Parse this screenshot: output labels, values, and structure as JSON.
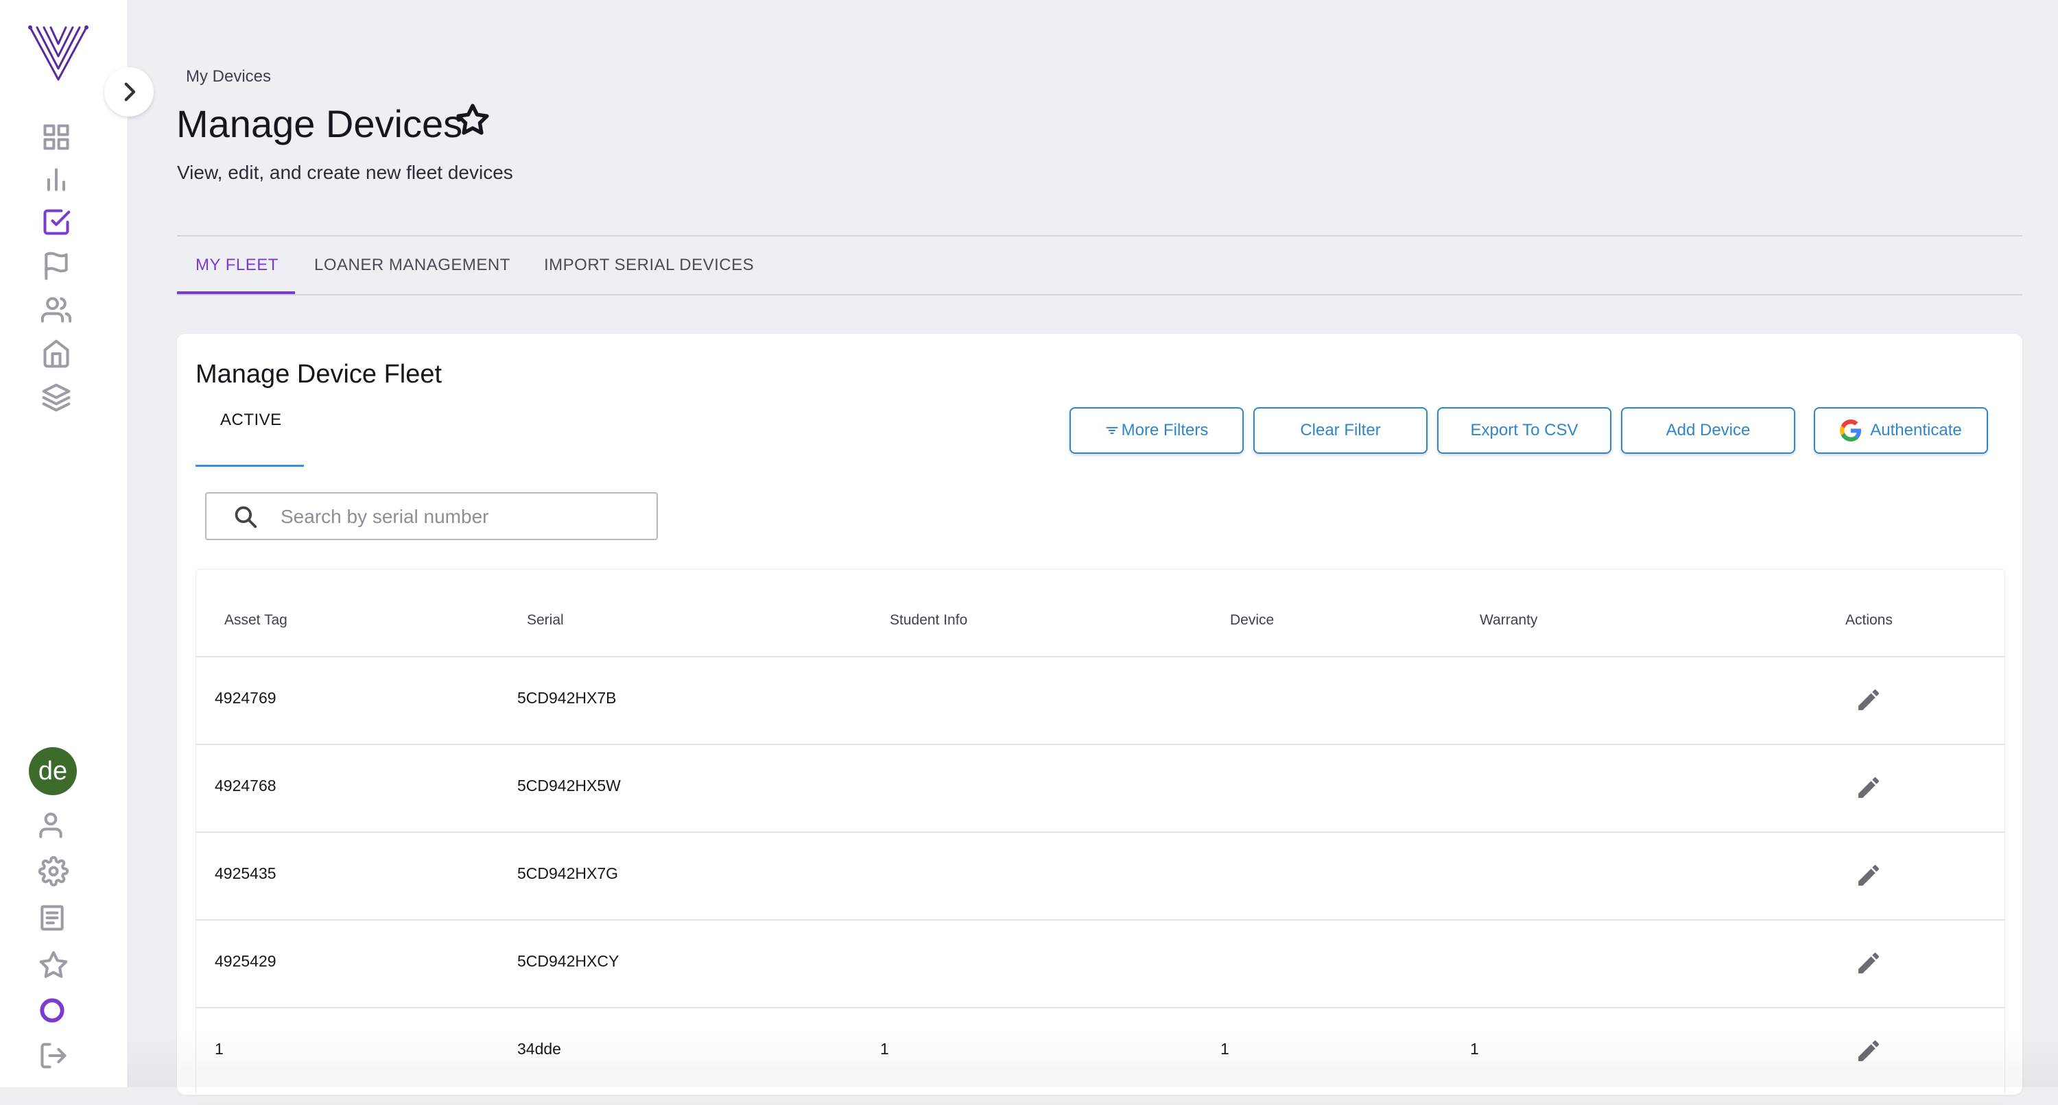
{
  "colors": {
    "accent": "#7a3cd0",
    "link": "#2f86c7",
    "avatar_bg": "#3d6b2c"
  },
  "sidebar": {
    "nav_icons": [
      "dashboard-icon",
      "bar-chart-icon",
      "checkbox-icon",
      "flag-icon",
      "users-icon",
      "home-icon",
      "layers-icon"
    ],
    "avatar_initials": "de",
    "bottom_icons": [
      "user-icon",
      "gear-icon",
      "document-icon",
      "star-icon",
      "circle-icon",
      "logout-icon"
    ]
  },
  "header": {
    "breadcrumb": "My Devices",
    "title": "Manage Devices",
    "subtitle": "View, edit, and create new fleet devices"
  },
  "tabs": [
    {
      "label": "MY FLEET",
      "active": true
    },
    {
      "label": "LOANER MANAGEMENT",
      "active": false
    },
    {
      "label": "IMPORT SERIAL DEVICES",
      "active": false
    }
  ],
  "card": {
    "title": "Manage Device Fleet",
    "subtab": "ACTIVE",
    "buttons": {
      "more_filters": "More Filters",
      "clear_filter": "Clear Filter",
      "export_csv": "Export To CSV",
      "add_device": "Add Device",
      "authenticate": "Authenticate"
    },
    "search": {
      "placeholder": "Search by serial number",
      "value": ""
    }
  },
  "table": {
    "columns": [
      "Asset Tag",
      "Serial",
      "Student Info",
      "Device",
      "Warranty",
      "Actions"
    ],
    "rows": [
      {
        "asset_tag": "4924769",
        "serial": "5CD942HX7B",
        "student_info": "",
        "device": "",
        "warranty": ""
      },
      {
        "asset_tag": "4924768",
        "serial": "5CD942HX5W",
        "student_info": "",
        "device": "",
        "warranty": ""
      },
      {
        "asset_tag": "4925435",
        "serial": "5CD942HX7G",
        "student_info": "",
        "device": "",
        "warranty": ""
      },
      {
        "asset_tag": "4925429",
        "serial": "5CD942HXCY",
        "student_info": "",
        "device": "",
        "warranty": ""
      },
      {
        "asset_tag": "1",
        "serial": "34dde",
        "student_info": "1",
        "device": "1",
        "warranty": "1"
      }
    ]
  }
}
